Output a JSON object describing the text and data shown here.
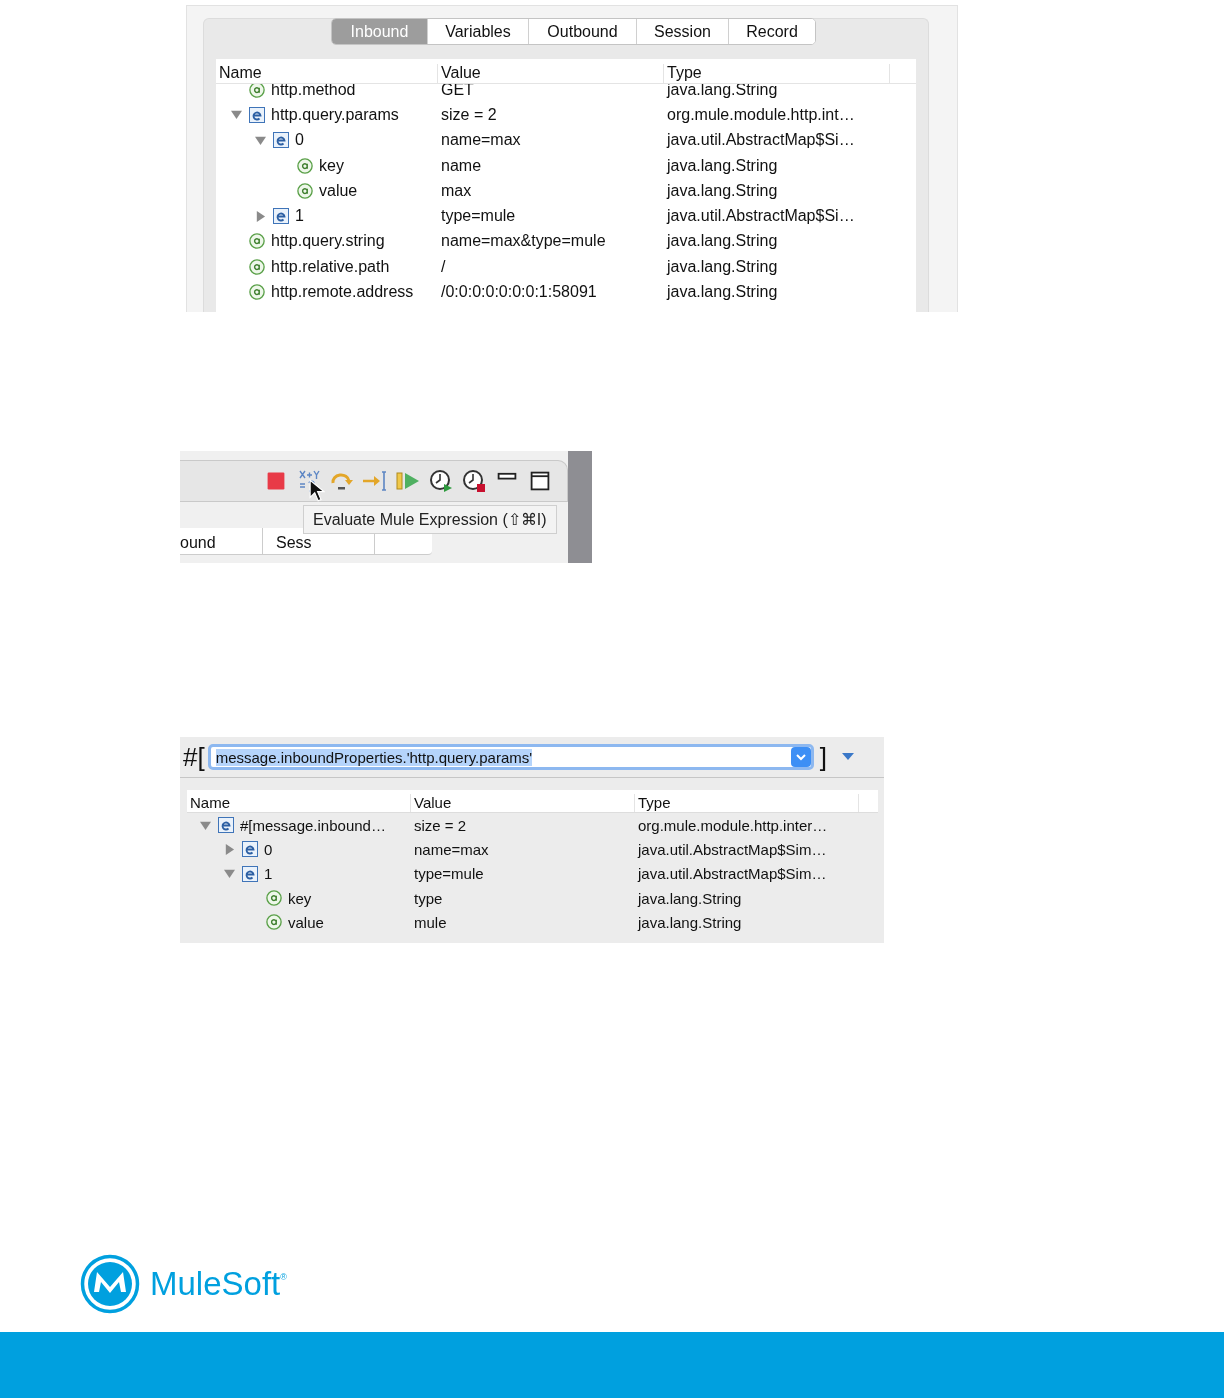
{
  "inspector": {
    "tabs": [
      {
        "label": "Inbound",
        "selected": true
      },
      {
        "label": "Variables",
        "selected": false
      },
      {
        "label": "Outbound",
        "selected": false
      },
      {
        "label": "Session",
        "selected": false
      },
      {
        "label": "Record",
        "selected": false
      }
    ],
    "columns": [
      "Name",
      "Value",
      "Type"
    ],
    "rows": [
      {
        "kind": "attribute",
        "name": "http.method",
        "value": "GET",
        "type": "java.lang.String"
      },
      {
        "kind": "element",
        "name": "http.query.params",
        "value": "size = 2",
        "type": "org.mule.module.http.int…",
        "expanded": true,
        "children": [
          {
            "kind": "element",
            "name": "0",
            "value": "name=max",
            "type": "java.util.AbstractMap$Si…",
            "expanded": true,
            "children": [
              {
                "kind": "attribute",
                "name": "key",
                "value": "name",
                "type": "java.lang.String"
              },
              {
                "kind": "attribute",
                "name": "value",
                "value": "max",
                "type": "java.lang.String"
              }
            ]
          },
          {
            "kind": "element",
            "name": "1",
            "value": "type=mule",
            "type": "java.util.AbstractMap$Si…",
            "expanded": false
          }
        ]
      },
      {
        "kind": "attribute",
        "name": "http.query.string",
        "value": "name=max&type=mule",
        "type": "java.lang.String"
      },
      {
        "kind": "attribute",
        "name": "http.relative.path",
        "value": "/",
        "type": "java.lang.String"
      },
      {
        "kind": "attribute",
        "name": "http.remote.address",
        "value": "/0:0:0:0:0:0:0:1:58091",
        "type": "java.lang.String"
      }
    ]
  },
  "toolbar_snippet": {
    "tabs": [
      "ound",
      "Sess"
    ],
    "tooltip": "Evaluate Mule Expression (⇧⌘I)"
  },
  "expression_view": {
    "prefix": "#[",
    "expression": "message.inboundProperties.'http.query.params'",
    "suffix": "]",
    "columns": [
      "Name",
      "Value",
      "Type"
    ],
    "rows": [
      {
        "kind": "element",
        "name": "#[message.inbound…",
        "value": "size = 2",
        "type": "org.mule.module.http.inter…",
        "expanded": true,
        "children": [
          {
            "kind": "element",
            "name": "0",
            "value": "name=max",
            "type": "java.util.AbstractMap$Sim…",
            "expanded": false
          },
          {
            "kind": "element",
            "name": "1",
            "value": "type=mule",
            "type": "java.util.AbstractMap$Sim…",
            "expanded": true,
            "children": [
              {
                "kind": "attribute",
                "name": "key",
                "value": "type",
                "type": "java.lang.String"
              },
              {
                "kind": "attribute",
                "name": "value",
                "value": "mule",
                "type": "java.lang.String"
              }
            ]
          }
        ]
      }
    ]
  },
  "logo": {
    "name": "MuleSoft",
    "mark": "®"
  }
}
